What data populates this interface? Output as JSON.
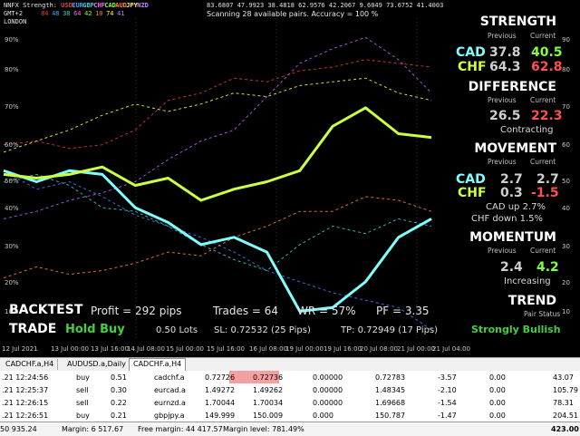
{
  "top_info": {
    "indicator_name": "NNFX Strength:",
    "currencies": [
      "USD",
      "EUR",
      "GBP",
      "CHF",
      "CAD",
      "AUD",
      "JPY",
      "NZD"
    ],
    "currency_colors": [
      "#e04040",
      "#40a0ff",
      "#40d0d0",
      "#ff60ff",
      "#80ff40",
      "#ff8040",
      "#ffff40",
      "#c080ff"
    ],
    "values": [
      "84",
      "48",
      "38",
      "64",
      "42",
      "10",
      "74",
      "41"
    ],
    "timezone": "GMT+2",
    "session": "LONDON",
    "numbers_line": "83.6807 47.9923 38.4818 62.9576 42.2067 9.6049 73.6752 41.4003",
    "scanning_text": "Scanning 28 available pairs. Accuracy = 100 %"
  },
  "axes": {
    "y_left": [
      "90%",
      "80%",
      "70%",
      "60%",
      "50%",
      "40%",
      "30%",
      "20%",
      "10%"
    ],
    "y_right": [
      "90",
      "80",
      "70",
      "60",
      "50",
      "40",
      "30",
      "20",
      "10"
    ],
    "x_labels": [
      "12 Jul 2021",
      "13 Jul 00:00",
      "13 Jul 16:00",
      "14 Jul 08:00",
      "15 Jul 00:00",
      "15 Jul 16:00",
      "16 Jul 08:00",
      "19 Jul 00:00",
      "19 Jul 16:00",
      "20 Jul 08:00",
      "21 Jul 00:00",
      "21 Jul 04:00"
    ]
  },
  "chart_data": {
    "type": "line",
    "x": [
      "12 Jul 2021",
      "13 Jul 00:00",
      "13 Jul 16:00",
      "14 Jul 08:00",
      "15 Jul 00:00",
      "15 Jul 16:00",
      "16 Jul 08:00",
      "19 Jul 00:00",
      "19 Jul 16:00",
      "20 Jul 08:00",
      "21 Jul 00:00",
      "21 Jul 04:00"
    ],
    "ylim": [
      10,
      95
    ],
    "series": [
      {
        "name": "CAD",
        "color": "#7fffff",
        "style": "solid",
        "values": [
          55,
          52,
          55,
          54,
          45,
          41,
          35,
          37,
          33,
          17,
          18,
          25,
          37,
          42
        ]
      },
      {
        "name": "CHF",
        "color": "#ccff44",
        "style": "solid",
        "values": [
          54,
          53,
          54,
          56,
          51,
          53,
          47,
          50,
          52,
          55,
          67,
          72,
          65,
          64
        ]
      },
      {
        "name": "USD",
        "color": "#e04040",
        "style": "dash",
        "values": [
          62,
          63,
          61,
          62,
          66,
          74,
          76,
          80,
          79,
          82,
          83,
          85,
          84,
          83
        ]
      },
      {
        "name": "JPY",
        "color": "#ffff40",
        "style": "dash",
        "values": [
          60,
          63,
          66,
          70,
          73,
          71,
          73,
          76,
          75,
          78,
          79,
          80,
          76,
          74
        ]
      },
      {
        "name": "EUR",
        "color": "#4080ff",
        "style": "dash",
        "values": [
          55,
          50,
          52,
          48,
          43,
          40,
          37,
          33,
          28,
          25,
          22,
          20,
          18,
          12
        ]
      },
      {
        "name": "GBP",
        "color": "#40d0d0",
        "style": "dash",
        "values": [
          52,
          54,
          51,
          45,
          44,
          40,
          35,
          31,
          28,
          35,
          40,
          38,
          42,
          40
        ]
      },
      {
        "name": "AUD",
        "color": "#ff8040",
        "style": "dash",
        "values": [
          26,
          29,
          27,
          28,
          30,
          33,
          32,
          37,
          40,
          44,
          44,
          48,
          47,
          44
        ]
      },
      {
        "name": "NZD",
        "color": "#c060ff",
        "style": "dash",
        "values": [
          42,
          44,
          47,
          49,
          52,
          58,
          63,
          66,
          75,
          84,
          88,
          91,
          85,
          76
        ]
      }
    ]
  },
  "panel": {
    "strength_title": "STRENGTH",
    "previous_label": "Previous",
    "current_label": "Current",
    "pair1": "CAD",
    "pair2": "CHF",
    "strength_prev1": "37.8",
    "strength_cur1": "40.5",
    "strength_prev2": "64.3",
    "strength_cur2": "62.8",
    "difference_title": "DIFFERENCE",
    "difference_prev": "26.5",
    "difference_cur": "22.3",
    "difference_state": "Contracting",
    "movement_title": "MOVEMENT",
    "movement_prev1": "2.7",
    "movement_cur1": "2.7",
    "movement_prev2": "0.3",
    "movement_cur2": "-1.5",
    "movement_note1": "CAD up 2.7%",
    "movement_note2": "CHF down 1.5%",
    "momentum_title": "MOMENTUM",
    "momentum_prev": "2.4",
    "momentum_cur": "4.2",
    "momentum_state": "Increasing",
    "trend_title": "TREND",
    "trend_sub": "Pair Status",
    "trend_state": "Strongly Bullish"
  },
  "backtest": {
    "label": "BACKTEST",
    "profit": "Profit = 292 pips",
    "trades": "Trades = 64",
    "wr": "WR = 57%",
    "pf": "PF = 3.35",
    "trade_label": "TRADE",
    "trade_action": "Hold Buy",
    "lots": "0.50 Lots",
    "sl": "SL: 0.72532 (25 Pips)",
    "tp": "TP: 0.72949 (17 Pips)"
  },
  "tabs": [
    "CADCHF.a,H4",
    "AUDUSD.a,Daily",
    "CADCHF.a,H4"
  ],
  "orders": [
    {
      "time": ".21 12:24:56",
      "type": "buy",
      "volume": "0.51",
      "symbol": "cadchf.a",
      "price": "0.72726",
      "current": "0.72736",
      "sl": "0.00000",
      "tp": "0.72783",
      "swap": "-3.57",
      "zero": "0.00",
      "profit": "43.07",
      "highlight": true
    },
    {
      "time": ".21 12:25:37",
      "type": "sell",
      "volume": "0.30",
      "symbol": "eurcad.a",
      "price": "1.49272",
      "current": "1.49262",
      "sl": "0.00000",
      "tp": "1.48345",
      "swap": "-2.10",
      "zero": "0.00",
      "profit": "105.79",
      "highlight": false
    },
    {
      "time": ".21 12:26:15",
      "type": "sell",
      "volume": "0.22",
      "symbol": "eurnzd.a",
      "price": "1.70044",
      "current": "1.70034",
      "sl": "0.00000",
      "tp": "1.69668",
      "swap": "-1.54",
      "zero": "0.00",
      "profit": "78.31",
      "highlight": false
    },
    {
      "time": ".21 12:26:51",
      "type": "buy",
      "volume": "0.21",
      "symbol": "gbpjpy.a",
      "price": "149.999",
      "current": "150.009",
      "sl": "0.000",
      "tp": "150.787",
      "swap": "-1.47",
      "zero": "0.00",
      "profit": "204.51",
      "highlight": false
    }
  ],
  "status": {
    "balance": "50 935.24",
    "margin": "Margin: 6 517.67",
    "free_margin": "Free margin: 44 417.57",
    "margin_level": "Margin level: 781.49%",
    "total": "423.00"
  }
}
